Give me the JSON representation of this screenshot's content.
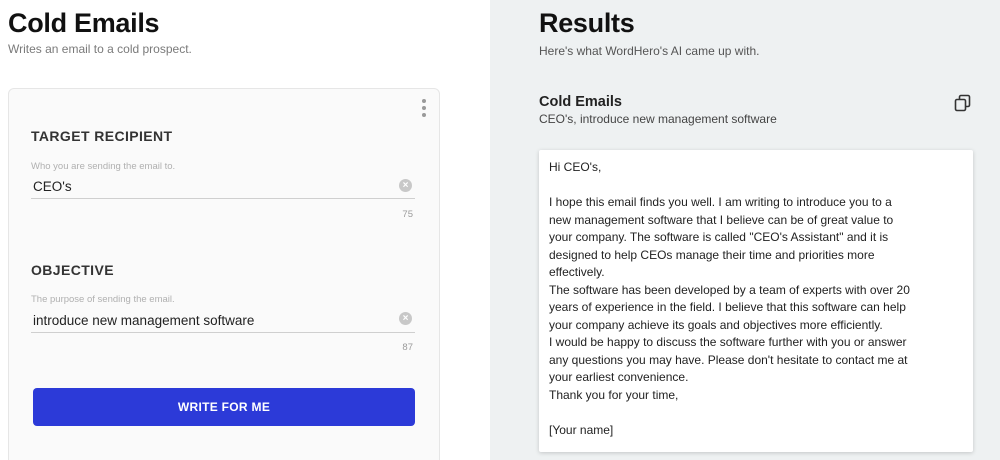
{
  "left": {
    "title": "Cold Emails",
    "subtitle": "Writes an email to a cold prospect.",
    "fields": [
      {
        "label": "TARGET RECIPIENT",
        "help": "Who you are sending the email to.",
        "value": "CEO's",
        "counter": "75",
        "clear_icon": "clear-icon"
      },
      {
        "label": "OBJECTIVE",
        "help": "The purpose of sending the email.",
        "value": "introduce new management software",
        "counter": "87",
        "clear_icon": "clear-icon"
      }
    ],
    "button_label": "WRITE FOR ME",
    "menu_icon": "kebab-menu-icon"
  },
  "right": {
    "title": "Results",
    "subtitle": "Here's what WordHero's AI came up with.",
    "result_name": "Cold Emails",
    "result_desc": "CEO's, introduce new management software",
    "copy_icon": "copy-icon",
    "email_lines": [
      "Hi CEO's,",
      "",
      "I hope this email finds you well. I am writing to introduce you to a",
      "new management software that I believe can be of great value to",
      "your company. The software is called \"CEO's Assistant\" and it is",
      "designed to help CEOs manage their time and priorities more",
      "effectively.",
      "The software has been developed by a team of experts with over 20",
      "years of experience in the field. I believe that this software can help",
      "your company achieve its goals and objectives more efficiently.",
      "I would be happy to discuss the software further with you or answer",
      "any questions you may have. Please don't hesitate to contact me at",
      "your earliest convenience.",
      "Thank you for your time,",
      "",
      "[Your name]"
    ]
  },
  "colors": {
    "accent": "#2c3ad8",
    "results_bg": "#eef1f2"
  }
}
